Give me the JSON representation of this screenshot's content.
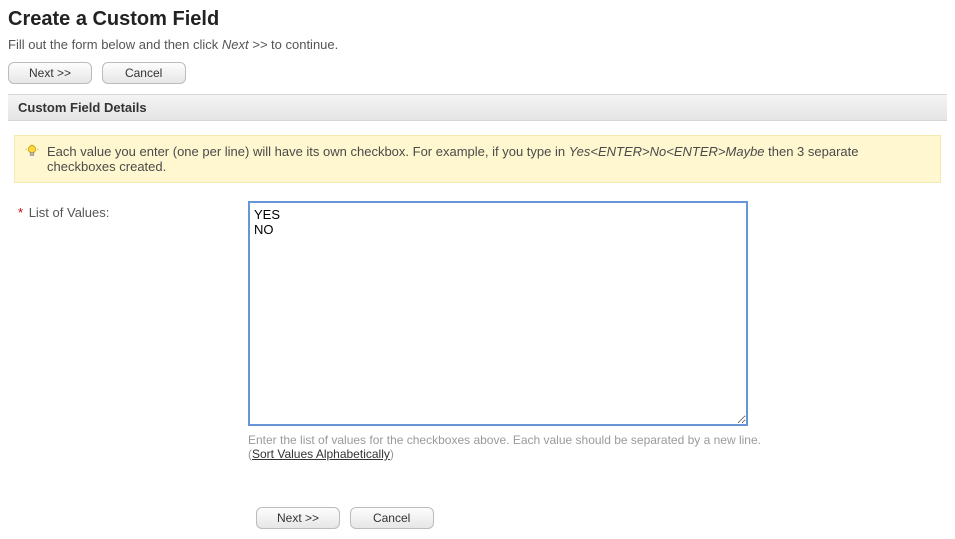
{
  "header": {
    "title": "Create a Custom Field",
    "instruction_prefix": "Fill out the form below and then click ",
    "instruction_italic": "Next >>",
    "instruction_suffix": " to continue."
  },
  "buttons": {
    "next": "Next >>",
    "cancel": "Cancel"
  },
  "section": {
    "title": "Custom Field Details"
  },
  "hint": {
    "text_prefix": "Each value you enter (one per line) will have its own checkbox. For example, if you type in ",
    "text_italic": "Yes<ENTER>No<ENTER>Maybe",
    "text_suffix": " then 3 separate checkboxes created."
  },
  "form": {
    "label": "List of Values:",
    "textarea_value": "YES\nNO",
    "help_text": "Enter the list of values for the checkboxes above. Each value should be separated by a new line.",
    "sort_link": "Sort Values Alphabetically"
  }
}
